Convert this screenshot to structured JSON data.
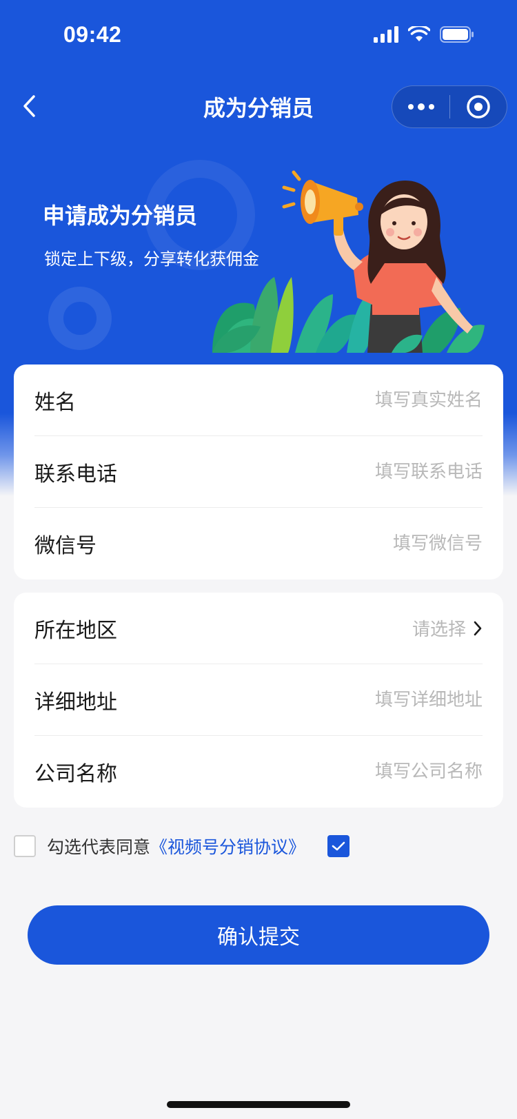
{
  "status_bar": {
    "time": "09:42"
  },
  "nav": {
    "title": "成为分销员"
  },
  "banner": {
    "title": "申请成为分销员",
    "subtitle": "锁定上下级，分享转化获佣金"
  },
  "form_basic": {
    "name": {
      "label": "姓名",
      "placeholder": "填写真实姓名"
    },
    "phone": {
      "label": "联系电话",
      "placeholder": "填写联系电话"
    },
    "wechat": {
      "label": "微信号",
      "placeholder": "填写微信号"
    }
  },
  "form_address": {
    "region": {
      "label": "所在地区",
      "value": "请选择"
    },
    "detail": {
      "label": "详细地址",
      "placeholder": "填写详细地址"
    },
    "company": {
      "label": "公司名称",
      "placeholder": "填写公司名称"
    }
  },
  "agreement": {
    "text": "勾选代表同意",
    "link": "《视频号分销协议》",
    "checked": true
  },
  "submit": {
    "label": "确认提交"
  },
  "colors": {
    "primary": "#1a56db",
    "placeholder": "#b8b8b8"
  }
}
